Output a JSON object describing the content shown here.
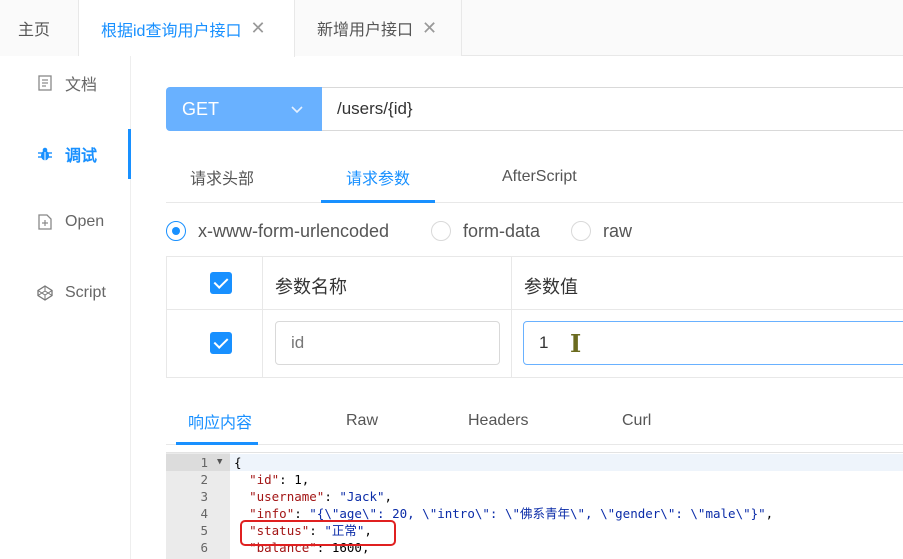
{
  "top_tabs": [
    {
      "label": "主页",
      "closable": false
    },
    {
      "label": "根据id查询用户接口",
      "closable": true,
      "active": true
    },
    {
      "label": "新增用户接口",
      "closable": true
    }
  ],
  "close_glyph": "✕",
  "sidebar": {
    "items": [
      {
        "label": "文档",
        "icon": "document-icon"
      },
      {
        "label": "调试",
        "icon": "bug-icon",
        "active": true
      },
      {
        "label": "Open",
        "icon": "file-icon"
      },
      {
        "label": "Script",
        "icon": "codepen-icon"
      }
    ]
  },
  "request": {
    "method": "GET",
    "url": "/users/{id}"
  },
  "request_tabs": [
    "请求头部",
    "请求参数",
    "AfterScript"
  ],
  "body_types": [
    "x-www-form-urlencoded",
    "form-data",
    "raw"
  ],
  "params": {
    "header_name": "参数名称",
    "header_value": "参数值",
    "rows": [
      {
        "name": "id",
        "value": "1",
        "checked": true
      }
    ]
  },
  "response_tabs": [
    "响应内容",
    "Raw",
    "Headers",
    "Curl"
  ],
  "editor": {
    "line_numbers": [
      "1",
      "2",
      "3",
      "4",
      "5",
      "6"
    ],
    "lines": [
      "{",
      "  \"id\": 1,",
      "  \"username\": \"Jack\",",
      "  \"info\": \"{\\\"age\\\": 20, \\\"intro\\\": \\\"佛系青年\\\", \\\"gender\\\": \\\"male\\\"}\",",
      "  \"status\": \"正常\",",
      "  \"balance\": 1600,"
    ]
  },
  "colors": {
    "accent": "#1890ff",
    "method_bg": "#69b1ff",
    "highlight_box": "#e02020"
  }
}
